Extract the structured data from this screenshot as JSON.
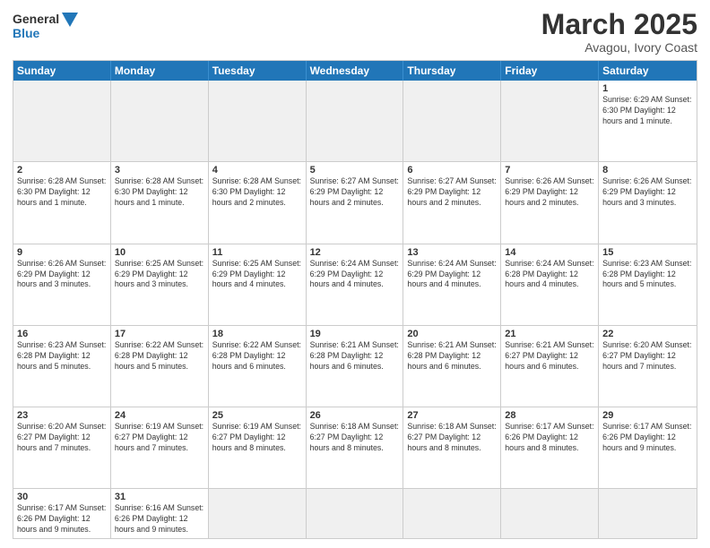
{
  "header": {
    "logo_general": "General",
    "logo_blue": "Blue",
    "month": "March 2025",
    "location": "Avagou, Ivory Coast"
  },
  "days": [
    "Sunday",
    "Monday",
    "Tuesday",
    "Wednesday",
    "Thursday",
    "Friday",
    "Saturday"
  ],
  "cells": [
    {
      "day": "",
      "empty": true,
      "text": ""
    },
    {
      "day": "",
      "empty": true,
      "text": ""
    },
    {
      "day": "",
      "empty": true,
      "text": ""
    },
    {
      "day": "",
      "empty": true,
      "text": ""
    },
    {
      "day": "",
      "empty": true,
      "text": ""
    },
    {
      "day": "",
      "empty": true,
      "text": ""
    },
    {
      "day": "1",
      "empty": false,
      "text": "Sunrise: 6:29 AM\nSunset: 6:30 PM\nDaylight: 12 hours\nand 1 minute."
    },
    {
      "day": "2",
      "empty": false,
      "text": "Sunrise: 6:28 AM\nSunset: 6:30 PM\nDaylight: 12 hours\nand 1 minute."
    },
    {
      "day": "3",
      "empty": false,
      "text": "Sunrise: 6:28 AM\nSunset: 6:30 PM\nDaylight: 12 hours\nand 1 minute."
    },
    {
      "day": "4",
      "empty": false,
      "text": "Sunrise: 6:28 AM\nSunset: 6:30 PM\nDaylight: 12 hours\nand 2 minutes."
    },
    {
      "day": "5",
      "empty": false,
      "text": "Sunrise: 6:27 AM\nSunset: 6:29 PM\nDaylight: 12 hours\nand 2 minutes."
    },
    {
      "day": "6",
      "empty": false,
      "text": "Sunrise: 6:27 AM\nSunset: 6:29 PM\nDaylight: 12 hours\nand 2 minutes."
    },
    {
      "day": "7",
      "empty": false,
      "text": "Sunrise: 6:26 AM\nSunset: 6:29 PM\nDaylight: 12 hours\nand 2 minutes."
    },
    {
      "day": "8",
      "empty": false,
      "text": "Sunrise: 6:26 AM\nSunset: 6:29 PM\nDaylight: 12 hours\nand 3 minutes."
    },
    {
      "day": "9",
      "empty": false,
      "text": "Sunrise: 6:26 AM\nSunset: 6:29 PM\nDaylight: 12 hours\nand 3 minutes."
    },
    {
      "day": "10",
      "empty": false,
      "text": "Sunrise: 6:25 AM\nSunset: 6:29 PM\nDaylight: 12 hours\nand 3 minutes."
    },
    {
      "day": "11",
      "empty": false,
      "text": "Sunrise: 6:25 AM\nSunset: 6:29 PM\nDaylight: 12 hours\nand 4 minutes."
    },
    {
      "day": "12",
      "empty": false,
      "text": "Sunrise: 6:24 AM\nSunset: 6:29 PM\nDaylight: 12 hours\nand 4 minutes."
    },
    {
      "day": "13",
      "empty": false,
      "text": "Sunrise: 6:24 AM\nSunset: 6:29 PM\nDaylight: 12 hours\nand 4 minutes."
    },
    {
      "day": "14",
      "empty": false,
      "text": "Sunrise: 6:24 AM\nSunset: 6:28 PM\nDaylight: 12 hours\nand 4 minutes."
    },
    {
      "day": "15",
      "empty": false,
      "text": "Sunrise: 6:23 AM\nSunset: 6:28 PM\nDaylight: 12 hours\nand 5 minutes."
    },
    {
      "day": "16",
      "empty": false,
      "text": "Sunrise: 6:23 AM\nSunset: 6:28 PM\nDaylight: 12 hours\nand 5 minutes."
    },
    {
      "day": "17",
      "empty": false,
      "text": "Sunrise: 6:22 AM\nSunset: 6:28 PM\nDaylight: 12 hours\nand 5 minutes."
    },
    {
      "day": "18",
      "empty": false,
      "text": "Sunrise: 6:22 AM\nSunset: 6:28 PM\nDaylight: 12 hours\nand 6 minutes."
    },
    {
      "day": "19",
      "empty": false,
      "text": "Sunrise: 6:21 AM\nSunset: 6:28 PM\nDaylight: 12 hours\nand 6 minutes."
    },
    {
      "day": "20",
      "empty": false,
      "text": "Sunrise: 6:21 AM\nSunset: 6:28 PM\nDaylight: 12 hours\nand 6 minutes."
    },
    {
      "day": "21",
      "empty": false,
      "text": "Sunrise: 6:21 AM\nSunset: 6:27 PM\nDaylight: 12 hours\nand 6 minutes."
    },
    {
      "day": "22",
      "empty": false,
      "text": "Sunrise: 6:20 AM\nSunset: 6:27 PM\nDaylight: 12 hours\nand 7 minutes."
    },
    {
      "day": "23",
      "empty": false,
      "text": "Sunrise: 6:20 AM\nSunset: 6:27 PM\nDaylight: 12 hours\nand 7 minutes."
    },
    {
      "day": "24",
      "empty": false,
      "text": "Sunrise: 6:19 AM\nSunset: 6:27 PM\nDaylight: 12 hours\nand 7 minutes."
    },
    {
      "day": "25",
      "empty": false,
      "text": "Sunrise: 6:19 AM\nSunset: 6:27 PM\nDaylight: 12 hours\nand 8 minutes."
    },
    {
      "day": "26",
      "empty": false,
      "text": "Sunrise: 6:18 AM\nSunset: 6:27 PM\nDaylight: 12 hours\nand 8 minutes."
    },
    {
      "day": "27",
      "empty": false,
      "text": "Sunrise: 6:18 AM\nSunset: 6:27 PM\nDaylight: 12 hours\nand 8 minutes."
    },
    {
      "day": "28",
      "empty": false,
      "text": "Sunrise: 6:17 AM\nSunset: 6:26 PM\nDaylight: 12 hours\nand 8 minutes."
    },
    {
      "day": "29",
      "empty": false,
      "text": "Sunrise: 6:17 AM\nSunset: 6:26 PM\nDaylight: 12 hours\nand 9 minutes."
    },
    {
      "day": "30",
      "empty": false,
      "text": "Sunrise: 6:17 AM\nSunset: 6:26 PM\nDaylight: 12 hours\nand 9 minutes."
    },
    {
      "day": "31",
      "empty": false,
      "text": "Sunrise: 6:16 AM\nSunset: 6:26 PM\nDaylight: 12 hours\nand 9 minutes."
    },
    {
      "day": "",
      "empty": true,
      "text": ""
    },
    {
      "day": "",
      "empty": true,
      "text": ""
    },
    {
      "day": "",
      "empty": true,
      "text": ""
    },
    {
      "day": "",
      "empty": true,
      "text": ""
    },
    {
      "day": "",
      "empty": true,
      "text": ""
    }
  ]
}
